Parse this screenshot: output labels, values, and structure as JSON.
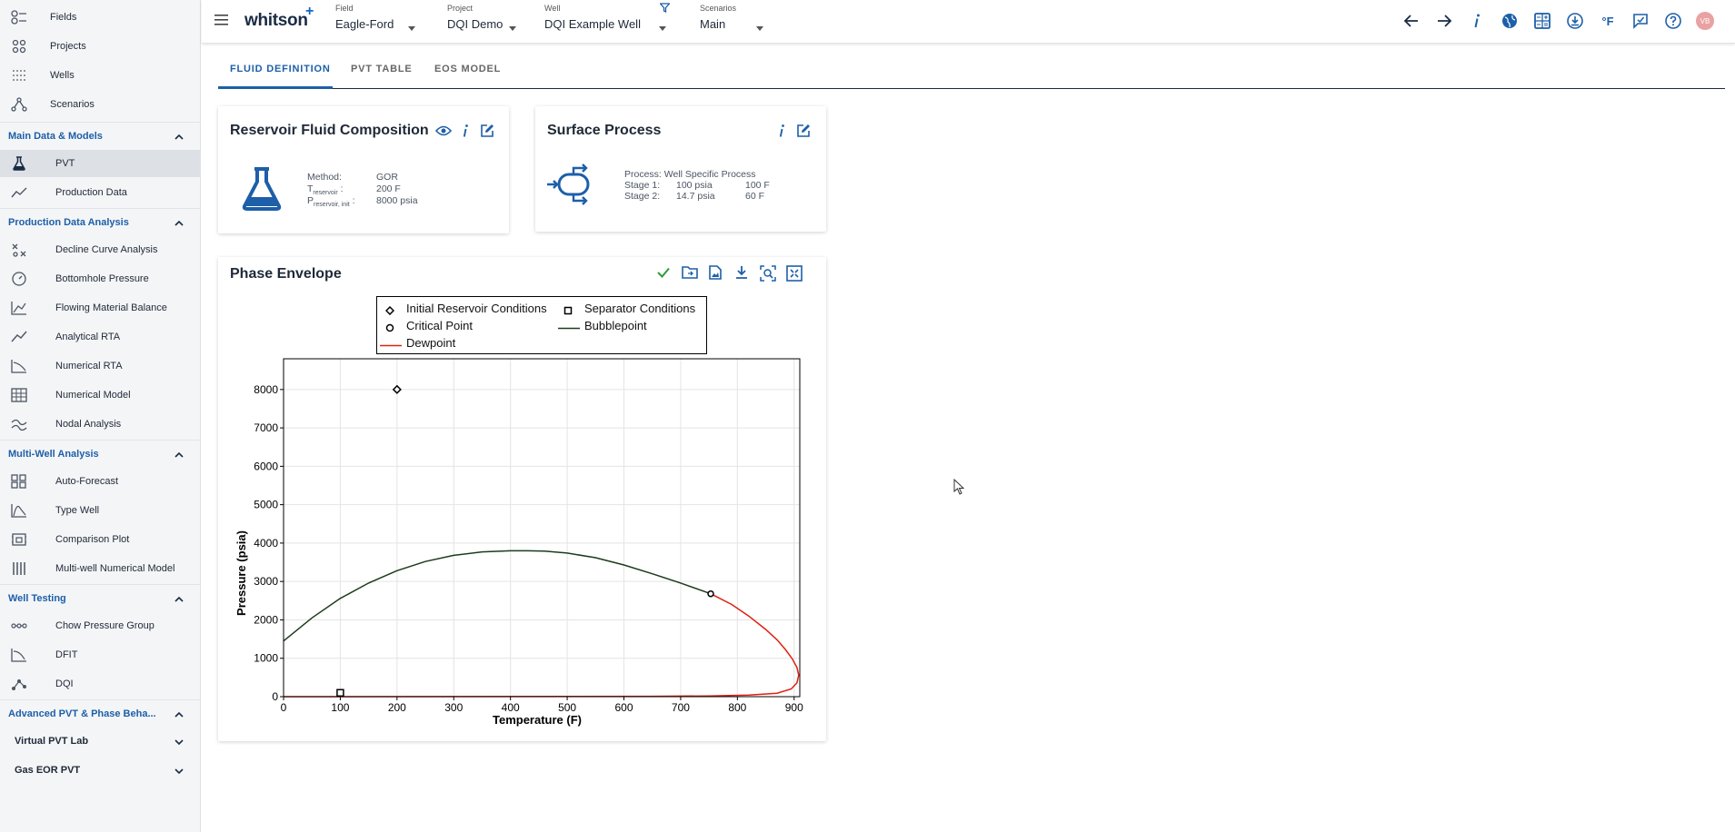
{
  "sidebar": {
    "top_items": [
      {
        "label": "Fields",
        "icon": "fields-icon"
      },
      {
        "label": "Projects",
        "icon": "projects-icon"
      },
      {
        "label": "Wells",
        "icon": "wells-icon"
      },
      {
        "label": "Scenarios",
        "icon": "scenarios-icon"
      }
    ],
    "sections": [
      {
        "title": "Main Data & Models",
        "items": [
          {
            "label": "PVT",
            "icon": "flask-icon",
            "active": true
          },
          {
            "label": "Production Data",
            "icon": "line-chart-icon"
          }
        ]
      },
      {
        "title": "Production Data Analysis",
        "items": [
          {
            "label": "Decline Curve Analysis",
            "icon": "decline-icon"
          },
          {
            "label": "Bottomhole Pressure",
            "icon": "gauge-icon"
          },
          {
            "label": "Flowing Material Balance",
            "icon": "fmb-icon"
          },
          {
            "label": "Analytical RTA",
            "icon": "rta-icon"
          },
          {
            "label": "Numerical RTA",
            "icon": "numerical-rta-icon"
          },
          {
            "label": "Numerical Model",
            "icon": "grid-model-icon"
          },
          {
            "label": "Nodal Analysis",
            "icon": "nodal-icon"
          }
        ]
      },
      {
        "title": "Multi-Well Analysis",
        "items": [
          {
            "label": "Auto-Forecast",
            "icon": "auto-forecast-icon"
          },
          {
            "label": "Type Well",
            "icon": "type-well-icon"
          },
          {
            "label": "Comparison Plot",
            "icon": "comparison-icon"
          },
          {
            "label": "Multi-well Numerical Model",
            "icon": "multiwell-icon"
          }
        ]
      },
      {
        "title": "Well Testing",
        "items": [
          {
            "label": "Chow Pressure Group",
            "icon": "chow-icon"
          },
          {
            "label": "DFIT",
            "icon": "dfit-icon"
          },
          {
            "label": "DQI",
            "icon": "dqi-icon"
          }
        ]
      },
      {
        "title": "Advanced PVT & Phase Beha...",
        "items": []
      }
    ],
    "collapsed": [
      {
        "label": "Virtual PVT Lab"
      },
      {
        "label": "Gas EOR PVT"
      }
    ]
  },
  "topbar": {
    "brand": "whitson",
    "brand_plus": "+",
    "selectors": [
      {
        "caption": "Field",
        "value": "Eagle-Ford"
      },
      {
        "caption": "Project",
        "value": "DQI Demo"
      },
      {
        "caption": "Well",
        "value": "DQI Example Well"
      },
      {
        "caption": "Scenarios",
        "value": "Main"
      }
    ],
    "unit_label": "°F",
    "avatar": "VB"
  },
  "tabs": [
    {
      "label": "FLUID DEFINITION",
      "active": true
    },
    {
      "label": "PVT TABLE"
    },
    {
      "label": "EOS MODEL"
    }
  ],
  "fluid_card": {
    "title": "Reservoir Fluid Composition",
    "method_label": "Method:",
    "method_value": "GOR",
    "t_label": "T",
    "t_sub": "reservoir",
    "t_suffix": ":",
    "t_value": "200 F",
    "p_label": "P",
    "p_sub": "reservoir, init",
    "p_suffix": ":",
    "p_value": "8000 psia"
  },
  "surface_card": {
    "title": "Surface Process",
    "process": "Process: Well Specific Process",
    "stages": [
      {
        "label": "Stage 1:",
        "pressure": "100 psia",
        "temp": "100 F"
      },
      {
        "label": "Stage 2:",
        "pressure": "14.7 psia",
        "temp": "60 F"
      }
    ]
  },
  "phase_card": {
    "title": "Phase Envelope"
  },
  "chart_data": {
    "type": "line",
    "title": "",
    "xlabel": "Temperature (F)",
    "ylabel": "Pressure (psia)",
    "xlim": [
      0,
      910
    ],
    "ylim": [
      0,
      8800
    ],
    "xticks": [
      0,
      100,
      200,
      300,
      400,
      500,
      600,
      700,
      800,
      900
    ],
    "yticks": [
      0,
      1000,
      2000,
      3000,
      4000,
      5000,
      6000,
      7000,
      8000
    ],
    "grid": true,
    "legend": [
      {
        "name": "Initial Reservoir Conditions",
        "marker": "diamond"
      },
      {
        "name": "Separator Conditions",
        "marker": "square"
      },
      {
        "name": "Critical Point",
        "marker": "circle"
      },
      {
        "name": "Bubblepoint",
        "color": "#1b3b1b"
      },
      {
        "name": "Dewpoint",
        "color": "#e02010"
      }
    ],
    "points": {
      "initial_reservoir": {
        "x": 200,
        "y": 8000
      },
      "separator": {
        "x": 100,
        "y": 100
      },
      "critical": {
        "x": 753,
        "y": 2680
      }
    },
    "bubblepoint": {
      "x": [
        0,
        50,
        100,
        150,
        200,
        250,
        300,
        350,
        400,
        430,
        460,
        500,
        550,
        600,
        650,
        700,
        753
      ],
      "y": [
        1450,
        2050,
        2560,
        2960,
        3280,
        3520,
        3680,
        3770,
        3800,
        3800,
        3790,
        3740,
        3620,
        3430,
        3200,
        2960,
        2680
      ]
    },
    "dewpoint": {
      "x": [
        753,
        790,
        820,
        850,
        870,
        885,
        897,
        905,
        908,
        905,
        895,
        870,
        820,
        750,
        650,
        500,
        300,
        100,
        0
      ],
      "y": [
        2680,
        2400,
        2100,
        1750,
        1480,
        1220,
        980,
        760,
        560,
        360,
        200,
        90,
        40,
        20,
        10,
        5,
        2,
        1,
        0
      ]
    }
  }
}
